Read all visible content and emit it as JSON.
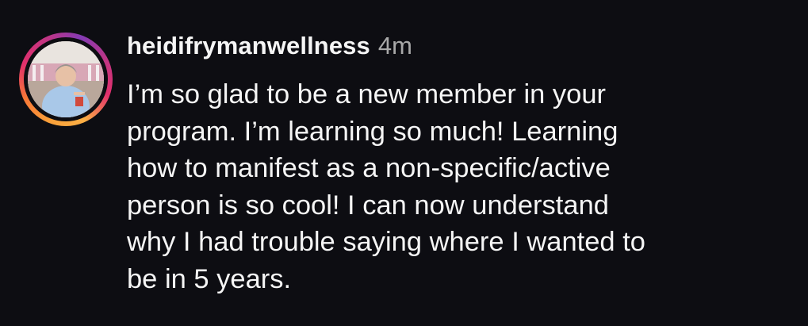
{
  "comment": {
    "username": "heidifrymanwellness",
    "timestamp": "4m",
    "text_lines": [
      "I’m so glad to be a new member in your",
      "program. I’m learning so much! Learning",
      "how to manifest as a non-specific/active",
      "person is so cool! I can now understand",
      "why I had trouble saying where I wanted to",
      "be in 5 years."
    ],
    "avatar_icon": "profile-photo",
    "colors": {
      "background": "#0d0d12",
      "text": "#f5f5f5",
      "timestamp": "#a8a8a8",
      "story_ring_start": "#f9a13a",
      "story_ring_end": "#c13584"
    }
  }
}
